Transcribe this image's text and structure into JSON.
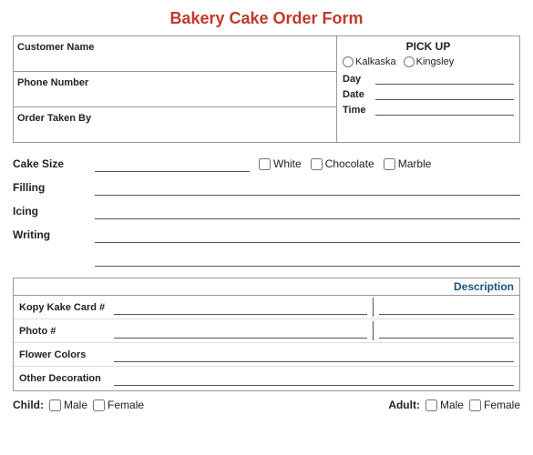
{
  "title": "Bakery Cake Order Form",
  "topLeft": {
    "customerName": "Customer Name",
    "phoneNumber": "Phone Number",
    "orderTakenBy": "Order Taken By"
  },
  "topRight": {
    "pickUpLabel": "PICK UP",
    "location1": "Kalkaska",
    "location2": "Kingsley",
    "dayLabel": "Day",
    "dateLabel": "Date",
    "timeLabel": "Time"
  },
  "cakeSection": {
    "cakeSizeLabel": "Cake Size",
    "whiteLabel": "White",
    "chocolateLabel": "Chocolate",
    "marbleLabel": "Marble",
    "fillingLabel": "Filling",
    "icingLabel": "Icing",
    "writingLabel": "Writing"
  },
  "descSection": {
    "headerLabel": "Description",
    "rows": [
      {
        "label": "Kopy Kake Card #"
      },
      {
        "label": "Photo #"
      },
      {
        "label": "Flower Colors"
      },
      {
        "label": "Other Decoration"
      }
    ]
  },
  "bottom": {
    "childLabel": "Child:",
    "childMale": "Male",
    "childFemale": "Female",
    "adultLabel": "Adult:",
    "adultMale": "Male",
    "adultFemale": "Female"
  }
}
